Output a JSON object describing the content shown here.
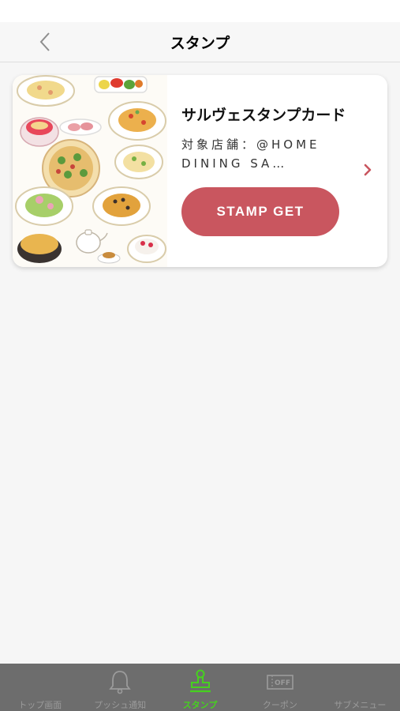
{
  "nav": {
    "title": "スタンプ"
  },
  "card": {
    "title": "サルヴェスタンプカード",
    "store": "対象店舗：@HOME DINING SA…",
    "button_label": "STAMP GET"
  },
  "tabs": [
    {
      "label": "トップ画面",
      "icon": "home-icon",
      "active": false
    },
    {
      "label": "プッシュ通知",
      "icon": "bell-icon",
      "active": false
    },
    {
      "label": "スタンプ",
      "icon": "stamp-icon",
      "active": true
    },
    {
      "label": "クーポン",
      "icon": "coupon-icon",
      "active": false
    },
    {
      "label": "サブメニュー",
      "icon": "menu-icon",
      "active": false
    }
  ],
  "coupon_icon_text": "OFF",
  "colors": {
    "accent": "#c9565f",
    "tab_active": "#46d11f",
    "tab_inactive": "#9b9b9b",
    "tab_bar": "#6d6d6d"
  }
}
